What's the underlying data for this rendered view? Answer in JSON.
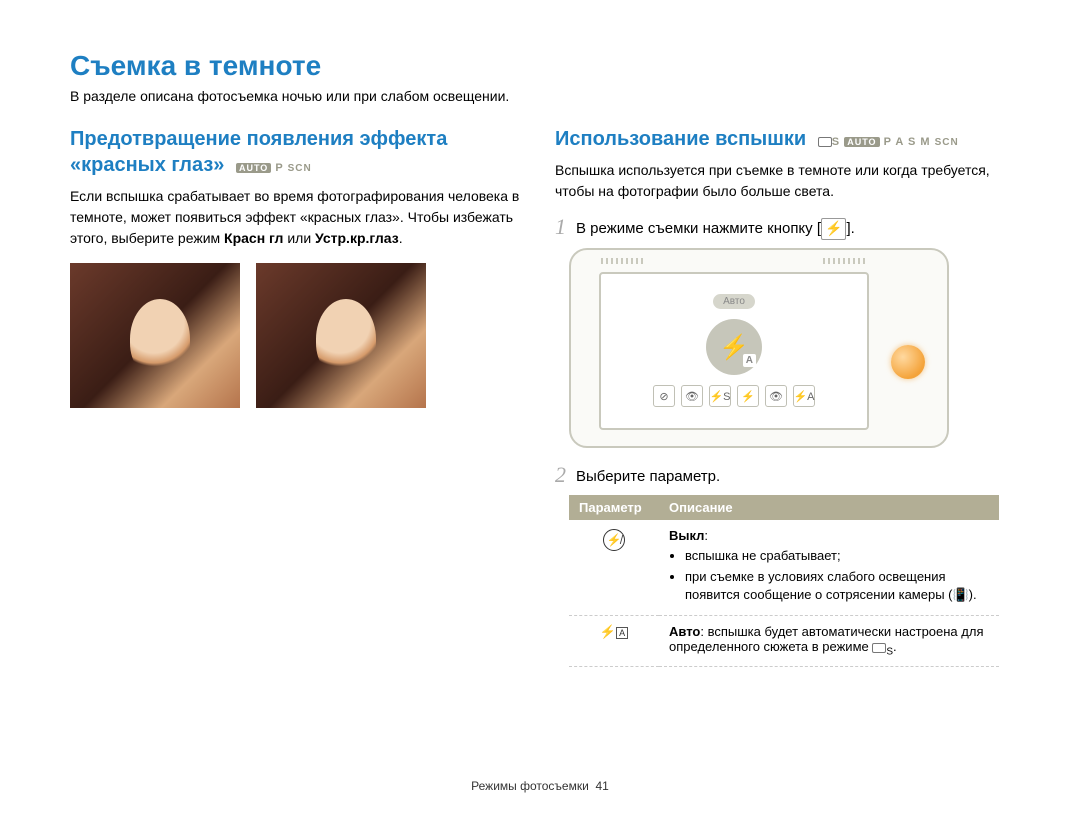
{
  "main_title": "Съемка в темноте",
  "subtitle": "В разделе описана фотосъемка ночью или при слабом освещении.",
  "left": {
    "heading": "Предотвращение появления эффекта «красных глаз»",
    "modes_html": "AUTO  P  SCN",
    "body": "Если вспышка срабатывает во время фотографирования человека в темноте, может появиться эффект «красных глаз». Чтобы избежать этого, выберите режим ",
    "body_bold1": "Красн гл",
    "body_mid": " или ",
    "body_bold2": "Устр.кр.глаз",
    "body_end": "."
  },
  "right": {
    "heading": "Использование вспышки",
    "modes_html": "S  AUTO  P  A  S  M  SCN",
    "intro": "Вспышка используется при съемке в темноте или когда требуется, чтобы на фотографии было больше света.",
    "step1_num": "1",
    "step1_text_a": "В режиме съемки нажмите кнопку [",
    "step1_text_b": "].",
    "step2_num": "2",
    "step2_text": "Выберите параметр.",
    "screen_label": "Авто",
    "table": {
      "header_param": "Параметр",
      "header_desc": "Описание",
      "rows": [
        {
          "icon": "⊘⚡",
          "title": "Выкл",
          "bullets": [
            "вспышка не срабатывает;",
            "при съемке в условиях слабого освещения появится сообщение о сотрясении камеры (📳)."
          ]
        },
        {
          "icon": "⚡A",
          "desc_prefix": "Авто",
          "desc": ": вспышка будет автоматически настроена для определенного сюжета в режиме ",
          "desc_suffix_icon": "S"
        }
      ]
    }
  },
  "footer": {
    "section": "Режимы фотосъемки",
    "page": "41"
  }
}
